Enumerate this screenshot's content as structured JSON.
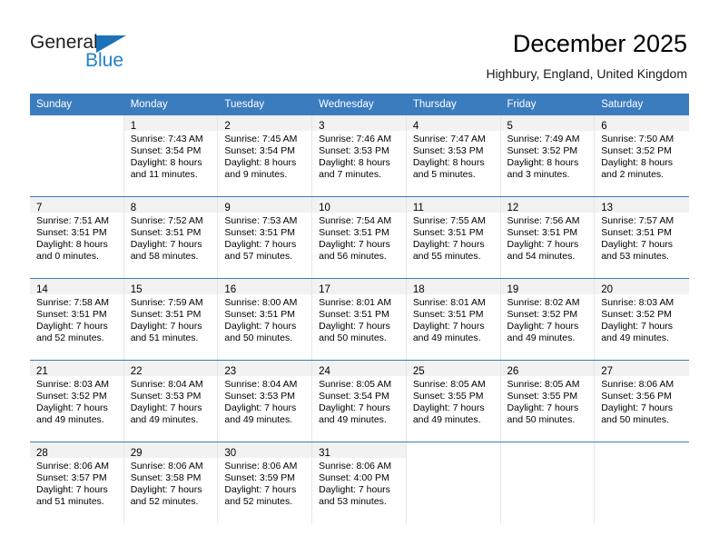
{
  "brand": {
    "name_part1": "General",
    "name_part2": "Blue",
    "color_dark": "#231f20",
    "color_blue": "#2581c4"
  },
  "header": {
    "title": "December 2025",
    "subtitle": "Highbury, England, United Kingdom"
  },
  "theme": {
    "header_blue": "#3b7cbf",
    "daynum_bg": "#f2f2f2",
    "cell_divider": "#e6e6e6"
  },
  "weekday_headers": [
    "Sunday",
    "Monday",
    "Tuesday",
    "Wednesday",
    "Thursday",
    "Friday",
    "Saturday"
  ],
  "weeks": [
    {
      "days": [
        {
          "num": "",
          "sunrise": "",
          "sunset": "",
          "daylight1": "",
          "daylight2": ""
        },
        {
          "num": "1",
          "sunrise": "Sunrise: 7:43 AM",
          "sunset": "Sunset: 3:54 PM",
          "daylight1": "Daylight: 8 hours",
          "daylight2": "and 11 minutes."
        },
        {
          "num": "2",
          "sunrise": "Sunrise: 7:45 AM",
          "sunset": "Sunset: 3:54 PM",
          "daylight1": "Daylight: 8 hours",
          "daylight2": "and 9 minutes."
        },
        {
          "num": "3",
          "sunrise": "Sunrise: 7:46 AM",
          "sunset": "Sunset: 3:53 PM",
          "daylight1": "Daylight: 8 hours",
          "daylight2": "and 7 minutes."
        },
        {
          "num": "4",
          "sunrise": "Sunrise: 7:47 AM",
          "sunset": "Sunset: 3:53 PM",
          "daylight1": "Daylight: 8 hours",
          "daylight2": "and 5 minutes."
        },
        {
          "num": "5",
          "sunrise": "Sunrise: 7:49 AM",
          "sunset": "Sunset: 3:52 PM",
          "daylight1": "Daylight: 8 hours",
          "daylight2": "and 3 minutes."
        },
        {
          "num": "6",
          "sunrise": "Sunrise: 7:50 AM",
          "sunset": "Sunset: 3:52 PM",
          "daylight1": "Daylight: 8 hours",
          "daylight2": "and 2 minutes."
        }
      ]
    },
    {
      "days": [
        {
          "num": "7",
          "sunrise": "Sunrise: 7:51 AM",
          "sunset": "Sunset: 3:51 PM",
          "daylight1": "Daylight: 8 hours",
          "daylight2": "and 0 minutes."
        },
        {
          "num": "8",
          "sunrise": "Sunrise: 7:52 AM",
          "sunset": "Sunset: 3:51 PM",
          "daylight1": "Daylight: 7 hours",
          "daylight2": "and 58 minutes."
        },
        {
          "num": "9",
          "sunrise": "Sunrise: 7:53 AM",
          "sunset": "Sunset: 3:51 PM",
          "daylight1": "Daylight: 7 hours",
          "daylight2": "and 57 minutes."
        },
        {
          "num": "10",
          "sunrise": "Sunrise: 7:54 AM",
          "sunset": "Sunset: 3:51 PM",
          "daylight1": "Daylight: 7 hours",
          "daylight2": "and 56 minutes."
        },
        {
          "num": "11",
          "sunrise": "Sunrise: 7:55 AM",
          "sunset": "Sunset: 3:51 PM",
          "daylight1": "Daylight: 7 hours",
          "daylight2": "and 55 minutes."
        },
        {
          "num": "12",
          "sunrise": "Sunrise: 7:56 AM",
          "sunset": "Sunset: 3:51 PM",
          "daylight1": "Daylight: 7 hours",
          "daylight2": "and 54 minutes."
        },
        {
          "num": "13",
          "sunrise": "Sunrise: 7:57 AM",
          "sunset": "Sunset: 3:51 PM",
          "daylight1": "Daylight: 7 hours",
          "daylight2": "and 53 minutes."
        }
      ]
    },
    {
      "days": [
        {
          "num": "14",
          "sunrise": "Sunrise: 7:58 AM",
          "sunset": "Sunset: 3:51 PM",
          "daylight1": "Daylight: 7 hours",
          "daylight2": "and 52 minutes."
        },
        {
          "num": "15",
          "sunrise": "Sunrise: 7:59 AM",
          "sunset": "Sunset: 3:51 PM",
          "daylight1": "Daylight: 7 hours",
          "daylight2": "and 51 minutes."
        },
        {
          "num": "16",
          "sunrise": "Sunrise: 8:00 AM",
          "sunset": "Sunset: 3:51 PM",
          "daylight1": "Daylight: 7 hours",
          "daylight2": "and 50 minutes."
        },
        {
          "num": "17",
          "sunrise": "Sunrise: 8:01 AM",
          "sunset": "Sunset: 3:51 PM",
          "daylight1": "Daylight: 7 hours",
          "daylight2": "and 50 minutes."
        },
        {
          "num": "18",
          "sunrise": "Sunrise: 8:01 AM",
          "sunset": "Sunset: 3:51 PM",
          "daylight1": "Daylight: 7 hours",
          "daylight2": "and 49 minutes."
        },
        {
          "num": "19",
          "sunrise": "Sunrise: 8:02 AM",
          "sunset": "Sunset: 3:52 PM",
          "daylight1": "Daylight: 7 hours",
          "daylight2": "and 49 minutes."
        },
        {
          "num": "20",
          "sunrise": "Sunrise: 8:03 AM",
          "sunset": "Sunset: 3:52 PM",
          "daylight1": "Daylight: 7 hours",
          "daylight2": "and 49 minutes."
        }
      ]
    },
    {
      "days": [
        {
          "num": "21",
          "sunrise": "Sunrise: 8:03 AM",
          "sunset": "Sunset: 3:52 PM",
          "daylight1": "Daylight: 7 hours",
          "daylight2": "and 49 minutes."
        },
        {
          "num": "22",
          "sunrise": "Sunrise: 8:04 AM",
          "sunset": "Sunset: 3:53 PM",
          "daylight1": "Daylight: 7 hours",
          "daylight2": "and 49 minutes."
        },
        {
          "num": "23",
          "sunrise": "Sunrise: 8:04 AM",
          "sunset": "Sunset: 3:53 PM",
          "daylight1": "Daylight: 7 hours",
          "daylight2": "and 49 minutes."
        },
        {
          "num": "24",
          "sunrise": "Sunrise: 8:05 AM",
          "sunset": "Sunset: 3:54 PM",
          "daylight1": "Daylight: 7 hours",
          "daylight2": "and 49 minutes."
        },
        {
          "num": "25",
          "sunrise": "Sunrise: 8:05 AM",
          "sunset": "Sunset: 3:55 PM",
          "daylight1": "Daylight: 7 hours",
          "daylight2": "and 49 minutes."
        },
        {
          "num": "26",
          "sunrise": "Sunrise: 8:05 AM",
          "sunset": "Sunset: 3:55 PM",
          "daylight1": "Daylight: 7 hours",
          "daylight2": "and 50 minutes."
        },
        {
          "num": "27",
          "sunrise": "Sunrise: 8:06 AM",
          "sunset": "Sunset: 3:56 PM",
          "daylight1": "Daylight: 7 hours",
          "daylight2": "and 50 minutes."
        }
      ]
    },
    {
      "days": [
        {
          "num": "28",
          "sunrise": "Sunrise: 8:06 AM",
          "sunset": "Sunset: 3:57 PM",
          "daylight1": "Daylight: 7 hours",
          "daylight2": "and 51 minutes."
        },
        {
          "num": "29",
          "sunrise": "Sunrise: 8:06 AM",
          "sunset": "Sunset: 3:58 PM",
          "daylight1": "Daylight: 7 hours",
          "daylight2": "and 52 minutes."
        },
        {
          "num": "30",
          "sunrise": "Sunrise: 8:06 AM",
          "sunset": "Sunset: 3:59 PM",
          "daylight1": "Daylight: 7 hours",
          "daylight2": "and 52 minutes."
        },
        {
          "num": "31",
          "sunrise": "Sunrise: 8:06 AM",
          "sunset": "Sunset: 4:00 PM",
          "daylight1": "Daylight: 7 hours",
          "daylight2": "and 53 minutes."
        },
        {
          "num": "",
          "sunrise": "",
          "sunset": "",
          "daylight1": "",
          "daylight2": ""
        },
        {
          "num": "",
          "sunrise": "",
          "sunset": "",
          "daylight1": "",
          "daylight2": ""
        },
        {
          "num": "",
          "sunrise": "",
          "sunset": "",
          "daylight1": "",
          "daylight2": ""
        }
      ]
    }
  ]
}
